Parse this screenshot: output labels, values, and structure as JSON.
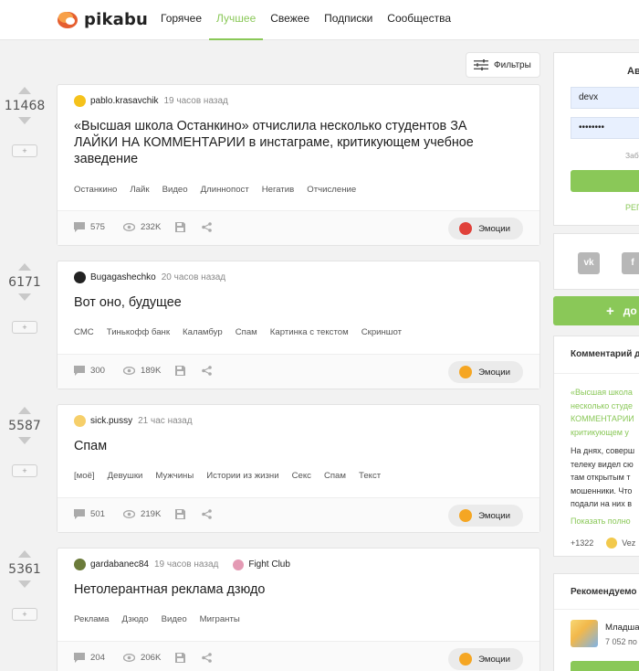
{
  "header": {
    "logo_text": "pikabu",
    "nav": [
      {
        "label": "Горячее",
        "active": false
      },
      {
        "label": "Лучшее",
        "active": true
      },
      {
        "label": "Свежее",
        "active": false
      },
      {
        "label": "Подписки",
        "active": false
      },
      {
        "label": "Сообщества",
        "active": false
      }
    ],
    "accent_color": "#8ac858"
  },
  "filters_label": "Фильтры",
  "stories": [
    {
      "rating": "11468",
      "author": "pablo.krasavchik",
      "time": "19 часов назад",
      "title": "«Высшая школа Останкино» отчислила несколько студентов ЗА ЛАЙКИ НА КОММЕНТАРИИ в инстаграме, критикующем учебное заведение",
      "tags": [
        "Останкино",
        "Лайк",
        "Видео",
        "Длиннопост",
        "Негатив",
        "Отчисление"
      ],
      "comments": "575",
      "views": "232K",
      "emotions_label": "Эмоции"
    },
    {
      "rating": "6171",
      "author": "Bugagashechko",
      "time": "20 часов назад",
      "title": "Вот оно, будущее",
      "tags": [
        "СМС",
        "Тинькофф банк",
        "Каламбур",
        "Спам",
        "Картинка с текстом",
        "Скриншот"
      ],
      "comments": "300",
      "views": "189K",
      "emotions_label": "Эмоции"
    },
    {
      "rating": "5587",
      "author": "sick.pussy",
      "time": "21 час назад",
      "title": "Спам",
      "tags": [
        "[моё]",
        "Девушки",
        "Мужчины",
        "Истории из жизни",
        "Секс",
        "Спам",
        "Текст"
      ],
      "comments": "501",
      "views": "219K",
      "emotions_label": "Эмоции"
    },
    {
      "rating": "5361",
      "author": "gardabanec84",
      "time": "19 часов назад",
      "community": "Fight Club",
      "title": "Нетолерантная реклама дзюдо",
      "tags": [
        "Реклама",
        "Дзюдо",
        "Видео",
        "Мигранты"
      ],
      "comments": "204",
      "views": "206K",
      "emotions_label": "Эмоции"
    }
  ],
  "sidebar": {
    "auth_title": "Авт",
    "login_value": "devx",
    "password_value": "••••••••",
    "forgot_text": "Заб",
    "register_text": "РЕГ",
    "social": [
      "vk",
      "f"
    ],
    "add_post_label": "до",
    "comment_box": {
      "title": "Комментарий д",
      "link_lines": [
        "«Высшая школа",
        "несколько студе",
        "КОММЕНТАРИИ",
        "критикующем у"
      ],
      "text_lines": [
        "На днях, соверш",
        "телеку видел сю",
        "там открытым т",
        "мошенники. Что",
        "подали на них в"
      ],
      "more_text": "Показать полно",
      "rating": "+1322",
      "author_short": "Vez"
    },
    "recommended": {
      "title": "Рекомендуемо",
      "name": "Младша",
      "sub": "7 052 по"
    }
  }
}
